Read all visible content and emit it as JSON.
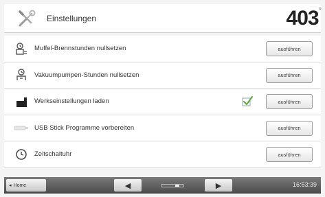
{
  "header": {
    "title": "Einstellungen",
    "icon": "wrench-screwdriver-icon",
    "temperature": "403",
    "temperature_unit": "°"
  },
  "rows": [
    {
      "icon": "muffle-hours-icon",
      "label": "Muffel-Brennstunden nullsetzen",
      "button": "ausführen"
    },
    {
      "icon": "vacuum-pump-icon",
      "label": "Vakuumpumpen-Stunden nullsetzen",
      "button": "ausführen"
    },
    {
      "icon": "factory-reset-icon",
      "label": "Werkseinstellungen laden",
      "button": "ausführen",
      "checked": true
    },
    {
      "icon": "usb-stick-icon",
      "label": "USB Stick Programme vorbereiten",
      "button": "ausführen"
    },
    {
      "icon": "timer-clock-icon",
      "label": "Zeitschaltuhr",
      "button": "ausführen"
    }
  ],
  "footer": {
    "home_label": "Home",
    "time": "16:53:39"
  },
  "colors": {
    "check": "#6aa84f",
    "footer_bar": "#5a5a5a"
  }
}
